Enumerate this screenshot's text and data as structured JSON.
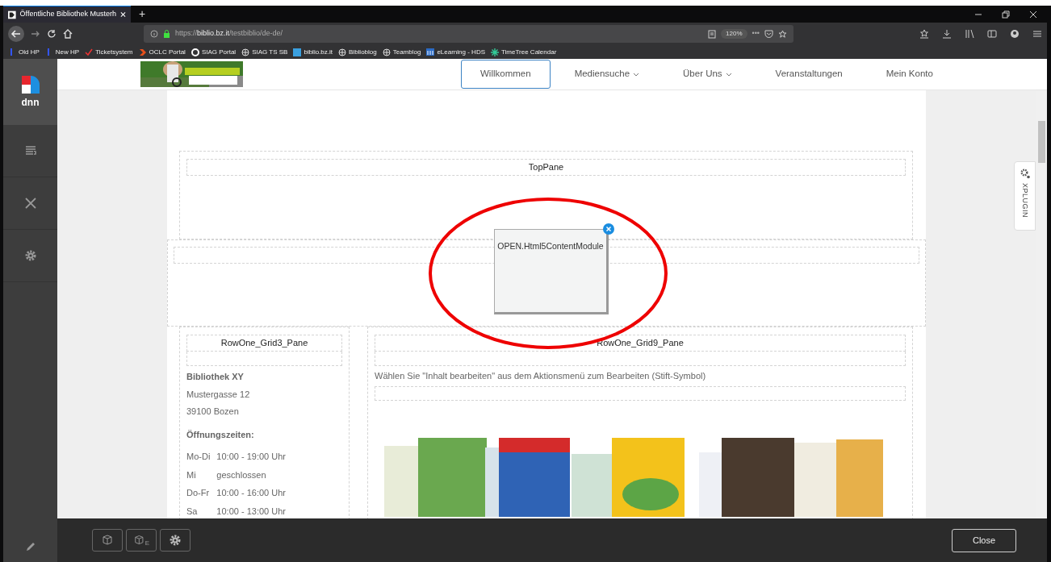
{
  "browser": {
    "tab_title": "Öffentliche Bibliothek Musterh",
    "new_tab": "+",
    "url": "https://**biblio.bz.it**/testbiblio/de-de/",
    "zoom": "120%",
    "more": "•••",
    "bookmarks": [
      {
        "label": "Old HP",
        "kind": "flag"
      },
      {
        "label": "New HP",
        "kind": "flag"
      },
      {
        "label": "Ticketsystem",
        "kind": "check"
      },
      {
        "label": "OCLC Portal",
        "kind": "chevron"
      },
      {
        "label": "SIAG Portal",
        "kind": "ring"
      },
      {
        "label": "SIAG TS SB",
        "kind": "globe"
      },
      {
        "label": "biblio.bz.it",
        "kind": "tile"
      },
      {
        "label": "Biblioblog",
        "kind": "globe"
      },
      {
        "label": "Teamblog",
        "kind": "globe"
      },
      {
        "label": "eLearning - HDS",
        "kind": "bars"
      },
      {
        "label": "TimeTree Calendar",
        "kind": "star"
      }
    ]
  },
  "dnn": {
    "logo": "dnn"
  },
  "nav": [
    {
      "label": "Willkommen",
      "selected": true,
      "dropdown": false
    },
    {
      "label": "Mediensuche",
      "selected": false,
      "dropdown": true
    },
    {
      "label": "Über Uns",
      "selected": false,
      "dropdown": true
    },
    {
      "label": "Veranstaltungen",
      "selected": false,
      "dropdown": false
    },
    {
      "label": "Mein Konto",
      "selected": false,
      "dropdown": false
    }
  ],
  "top_pane": {
    "label": "TopPane"
  },
  "left_pane": {
    "label": "RowOne_Grid3_Pane",
    "name": "Bibliothek XY",
    "address": [
      "Mustergasse 12",
      "39100 Bozen"
    ],
    "hours_heading": "Öffnungszeiten:",
    "hours": [
      {
        "day": "Mo-Di",
        "time": "10:00 - 19:00 Uhr"
      },
      {
        "day": "Mi",
        "time": "geschlossen"
      },
      {
        "day": "Do-Fr",
        "time": "10:00 - 16:00 Uhr"
      },
      {
        "day": "Sa",
        "time": "10:00 - 13:00 Uhr"
      }
    ]
  },
  "right_pane": {
    "label": "RowOne_Grid9_Pane",
    "hint": "Wählen Sie \"Inhalt bearbeiten\" aus dem Aktionsmenü zum Bearbeiten (Stift-Symbol)"
  },
  "dragged_module": {
    "title": "OPEN.Html5ContentModule"
  },
  "side_tab": {
    "label": "XPLUGIN"
  },
  "edit_bar": {
    "tools": [
      {
        "kind": "module"
      },
      {
        "kind": "module",
        "sub": "E"
      },
      {
        "kind": "settings"
      }
    ],
    "close": "Close"
  }
}
